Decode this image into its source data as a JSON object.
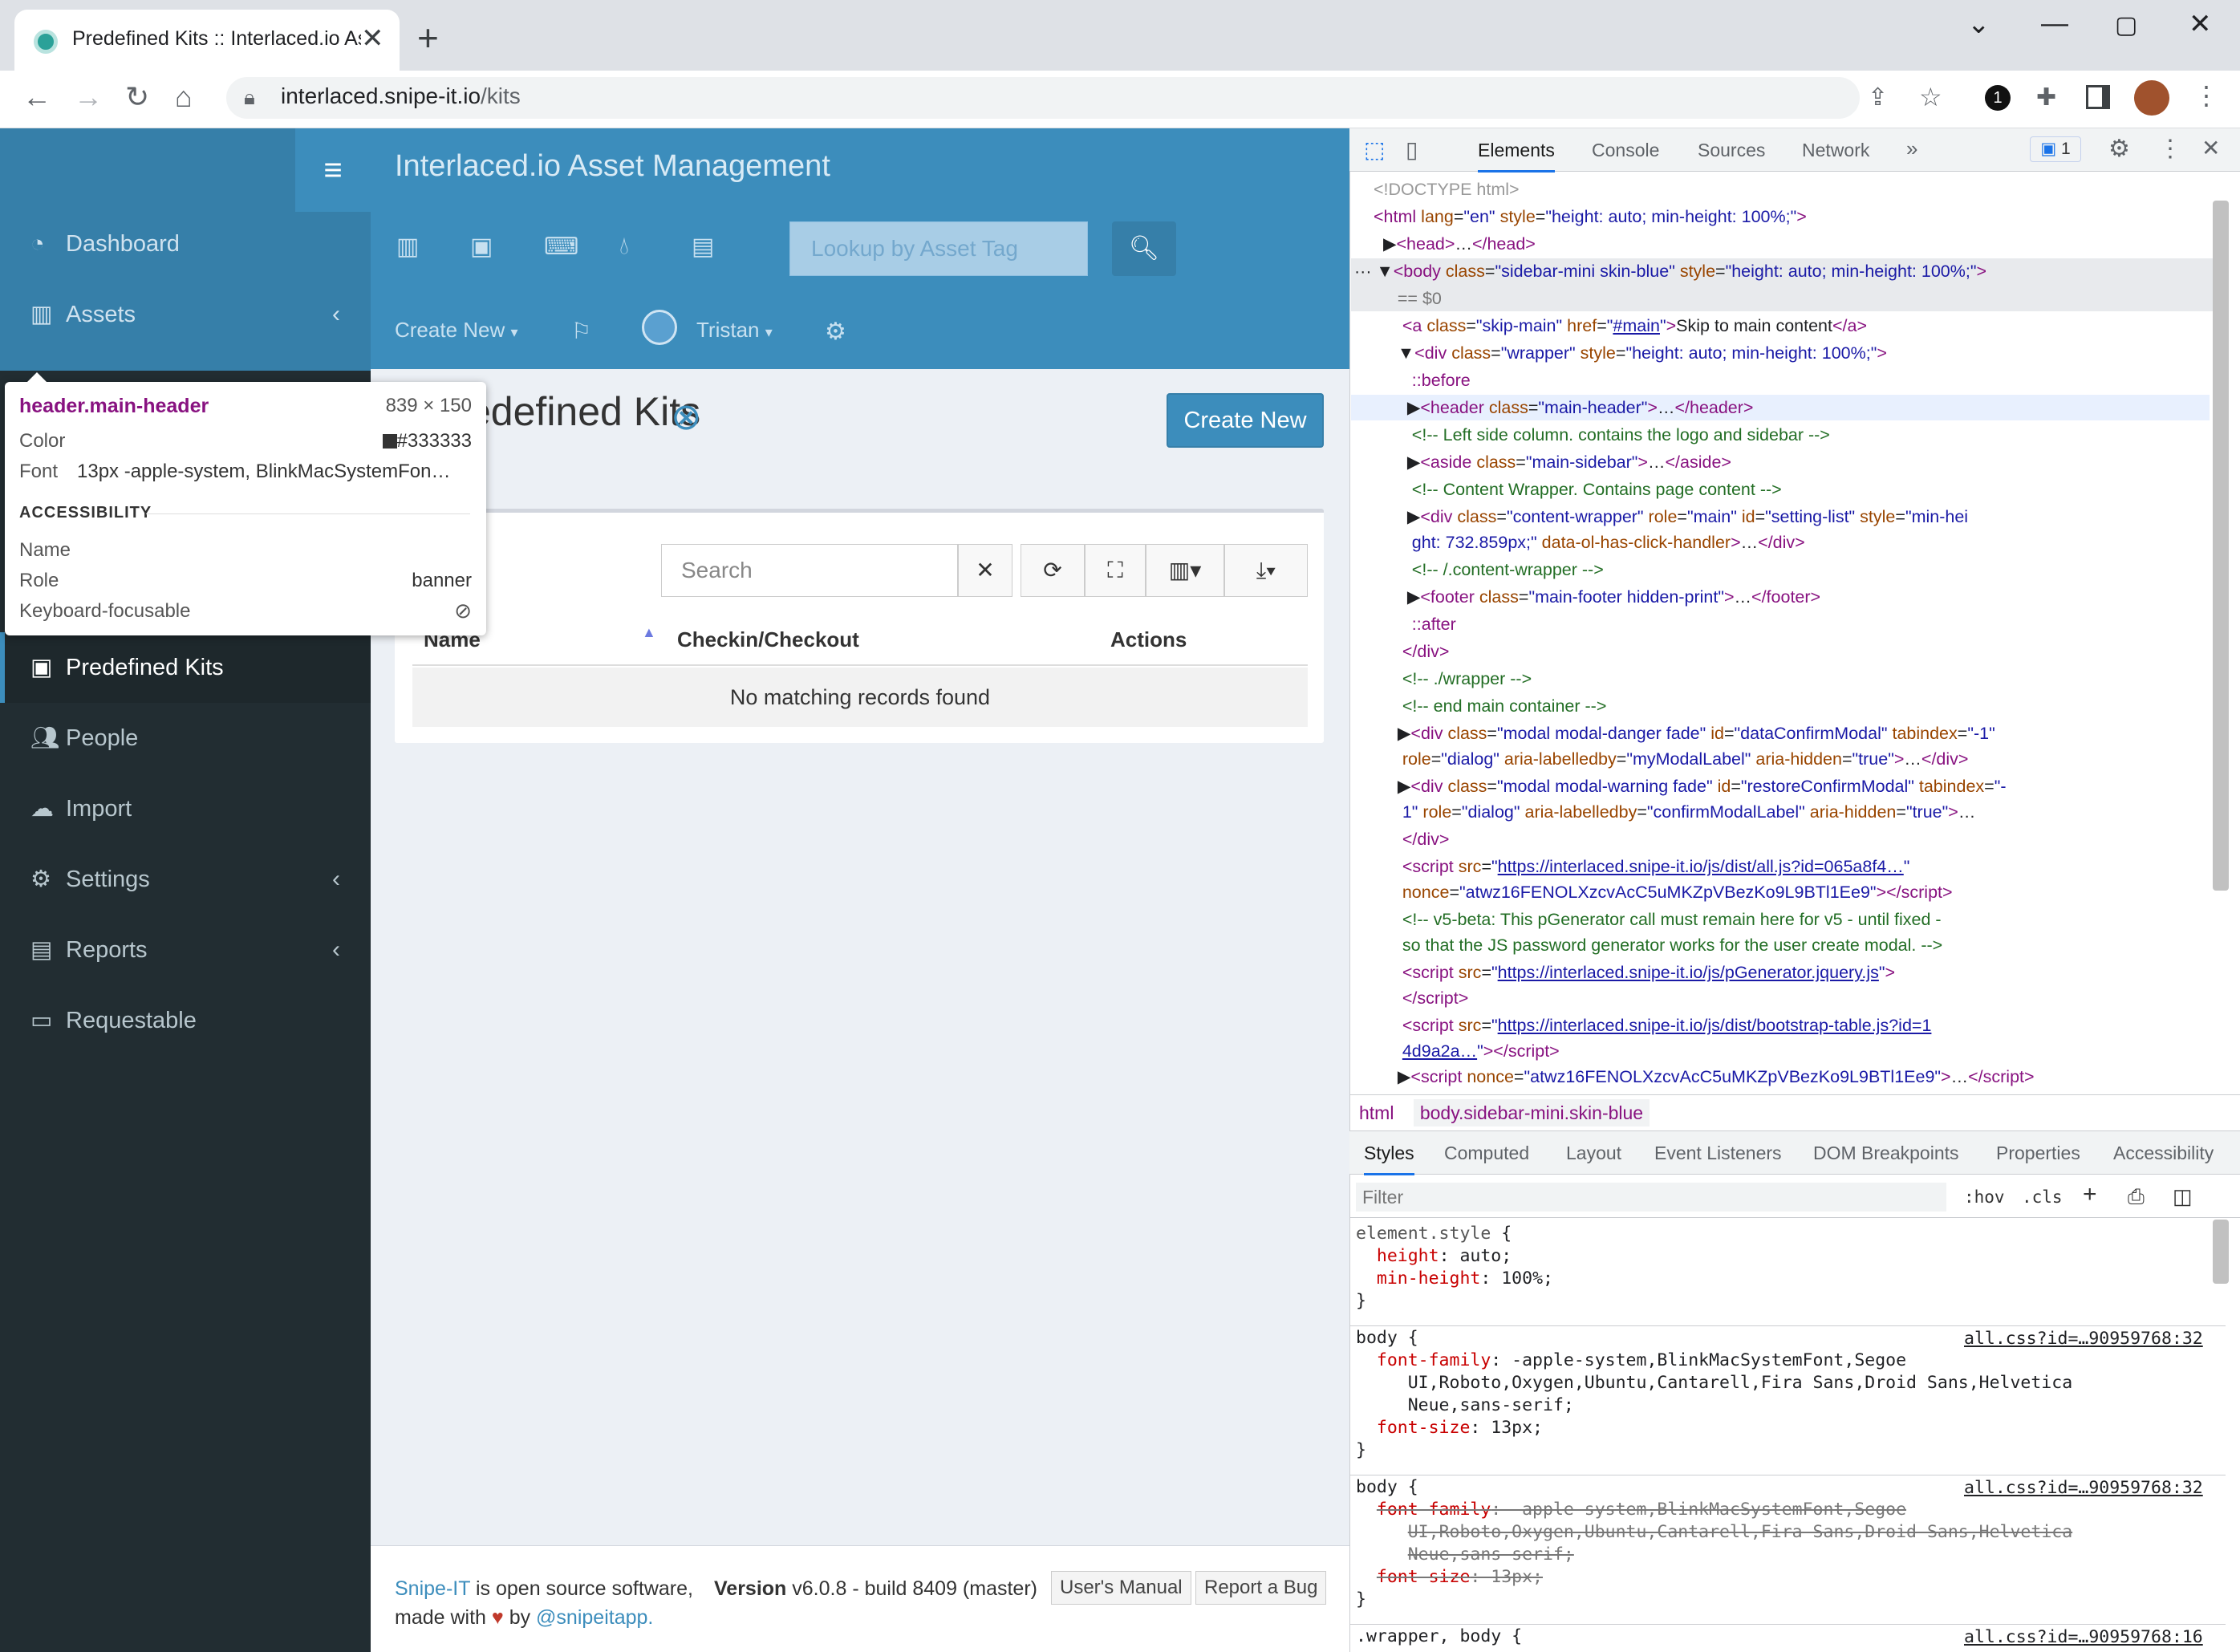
{
  "browser": {
    "tab_title": "Predefined Kits :: Interlaced.io As",
    "new_tab": "+",
    "url_host": "interlaced.snipe-it.io",
    "url_path": "/kits"
  },
  "app": {
    "brand": "Interlaced.io Asset Management",
    "lookup_placeholder": "Lookup by Asset Tag",
    "create_new_menu": "Create New",
    "user_menu": "Tristan",
    "sidebar": [
      {
        "label": "Dashboard",
        "icon": "dashboard-icon"
      },
      {
        "label": "Assets",
        "icon": "barcode-icon",
        "chevron": "‹"
      },
      {
        "label": "Predefined Kits",
        "icon": "kit-icon",
        "active": true
      },
      {
        "label": "People",
        "icon": "users-icon"
      },
      {
        "label": "Import",
        "icon": "cloud-upload-icon"
      },
      {
        "label": "Settings",
        "icon": "gear-icon",
        "chevron": "‹"
      },
      {
        "label": "Reports",
        "icon": "chart-icon",
        "chevron": "‹"
      },
      {
        "label": "Requestable",
        "icon": "laptop-icon"
      }
    ],
    "page_title": "edefined Kits",
    "create_button": "Create New",
    "search_placeholder": "Search",
    "table": {
      "headers": [
        "Name",
        "Checkin/Checkout",
        "Actions"
      ],
      "empty_message": "No matching records found"
    },
    "footer": {
      "snipe_link": "Snipe-IT",
      "text1": " is open source software,",
      "text2": "made with",
      "heart": "♥",
      "by": " by ",
      "handle": "@snipeitapp.",
      "version_label": "Version",
      "version": " v6.0.8 - build 8409 (master)",
      "manual": "User's Manual",
      "bug": "Report a Bug"
    }
  },
  "tooltip": {
    "selector": "header.main-header",
    "size": "839 × 150",
    "color_label": "Color",
    "color_value": "#333333",
    "font_label": "Font",
    "font_value": "13px -apple-system, BlinkMacSystemFon…",
    "section": "ACCESSIBILITY",
    "name_label": "Name",
    "role_label": "Role",
    "role_value": "banner",
    "kbd_label": "Keyboard-focusable"
  },
  "devtools": {
    "tabs": [
      "Elements",
      "Console",
      "Sources",
      "Network"
    ],
    "issues_count": "1",
    "breadcrumb": [
      "html",
      "body.sidebar-mini.skin-blue"
    ],
    "style_tabs": [
      "Styles",
      "Computed",
      "Layout",
      "Event Listeners",
      "DOM Breakpoints",
      "Properties",
      "Accessibility"
    ],
    "filter_placeholder": "Filter",
    "hov": ":hov",
    "cls": ".cls",
    "css_source": "all.css?id=…90959768:32",
    "css_source2": "all.css?id=…90959768:16"
  }
}
